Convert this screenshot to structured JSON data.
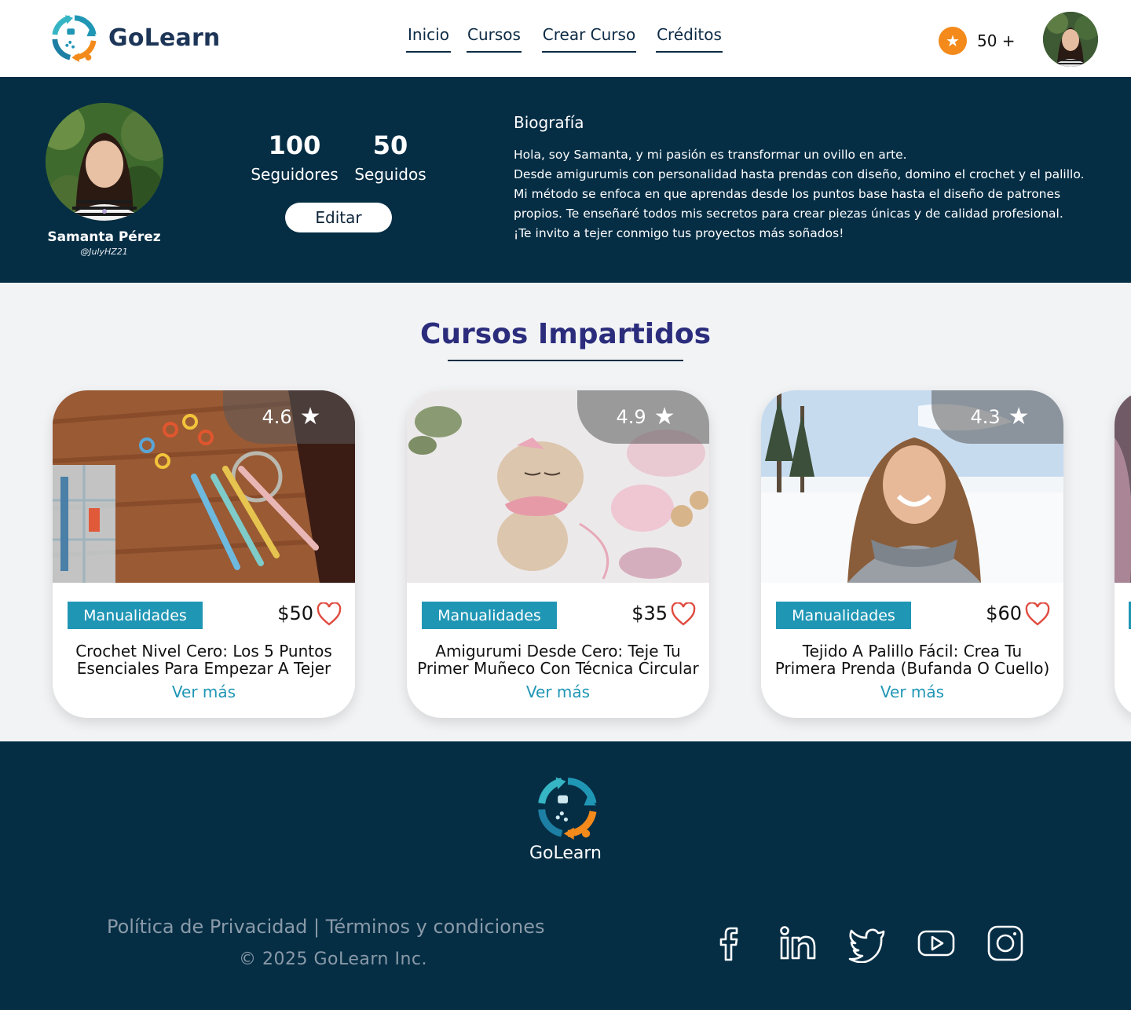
{
  "brand": {
    "name": "GoLearn",
    "accent": "#2096b5",
    "navy": "#052e45",
    "orange": "#f38a1b",
    "icon": "golearn-logo"
  },
  "nav": {
    "items": [
      {
        "label": "Inicio"
      },
      {
        "label": "Cursos"
      },
      {
        "label": "Crear Curso"
      },
      {
        "label": "Créditos"
      }
    ]
  },
  "header": {
    "credits": "50 +",
    "credits_icon": "star-coin-icon",
    "avatar_icon": "user-avatar"
  },
  "profile": {
    "name": "Samanta Pérez",
    "handle": "@JulyHZ21",
    "followers_count": "100",
    "followers_label": "Seguidores",
    "following_count": "50",
    "following_label": "Seguidos",
    "edit_label": "Editar",
    "bio_title": "Biografía",
    "bio_lines": [
      "Hola, soy Samanta, y mi pasión es transformar un ovillo en arte.",
      "Desde amigurumis con personalidad hasta prendas con diseño, domino el crochet y el palillo. Mi método se enfoca en que aprendas desde los puntos base hasta el diseño de patrones propios. Te enseñaré todos mis secretos para crear piezas únicas y de calidad profesional.",
      "¡Te invito a tejer conmigo tus proyectos más soñados!"
    ]
  },
  "courses": {
    "title": "Cursos Impartidos",
    "items": [
      {
        "rating": "4.6",
        "category": "Manualidades",
        "price": "$50",
        "title": "Crochet Nivel Cero: Los 5 Puntos Esenciales Para Empezar A Tejer",
        "link": "Ver más",
        "image": "crochet-tools-photo"
      },
      {
        "rating": "4.9",
        "category": "Manualidades",
        "price": "$35",
        "title": "Amigurumi Desde Cero: Teje Tu Primer Muñeco Con Técnica Circular",
        "link": "Ver más",
        "image": "amigurumi-deer-photo"
      },
      {
        "rating": "4.3",
        "category": "Manualidades",
        "price": "$60",
        "title": "Tejido A Palillo Fácil: Crea Tu Primera Prenda (Bufanda O Cuello)",
        "link": "Ver más",
        "image": "woman-scarf-snow-photo"
      }
    ]
  },
  "footer": {
    "brand": "GoLearn",
    "links_text": "Política de Privacidad | Términos y condiciones",
    "copyright": "© 2025 GoLearn Inc.",
    "social": [
      "facebook-icon",
      "linkedin-icon",
      "twitter-icon",
      "youtube-icon",
      "instagram-icon"
    ]
  }
}
